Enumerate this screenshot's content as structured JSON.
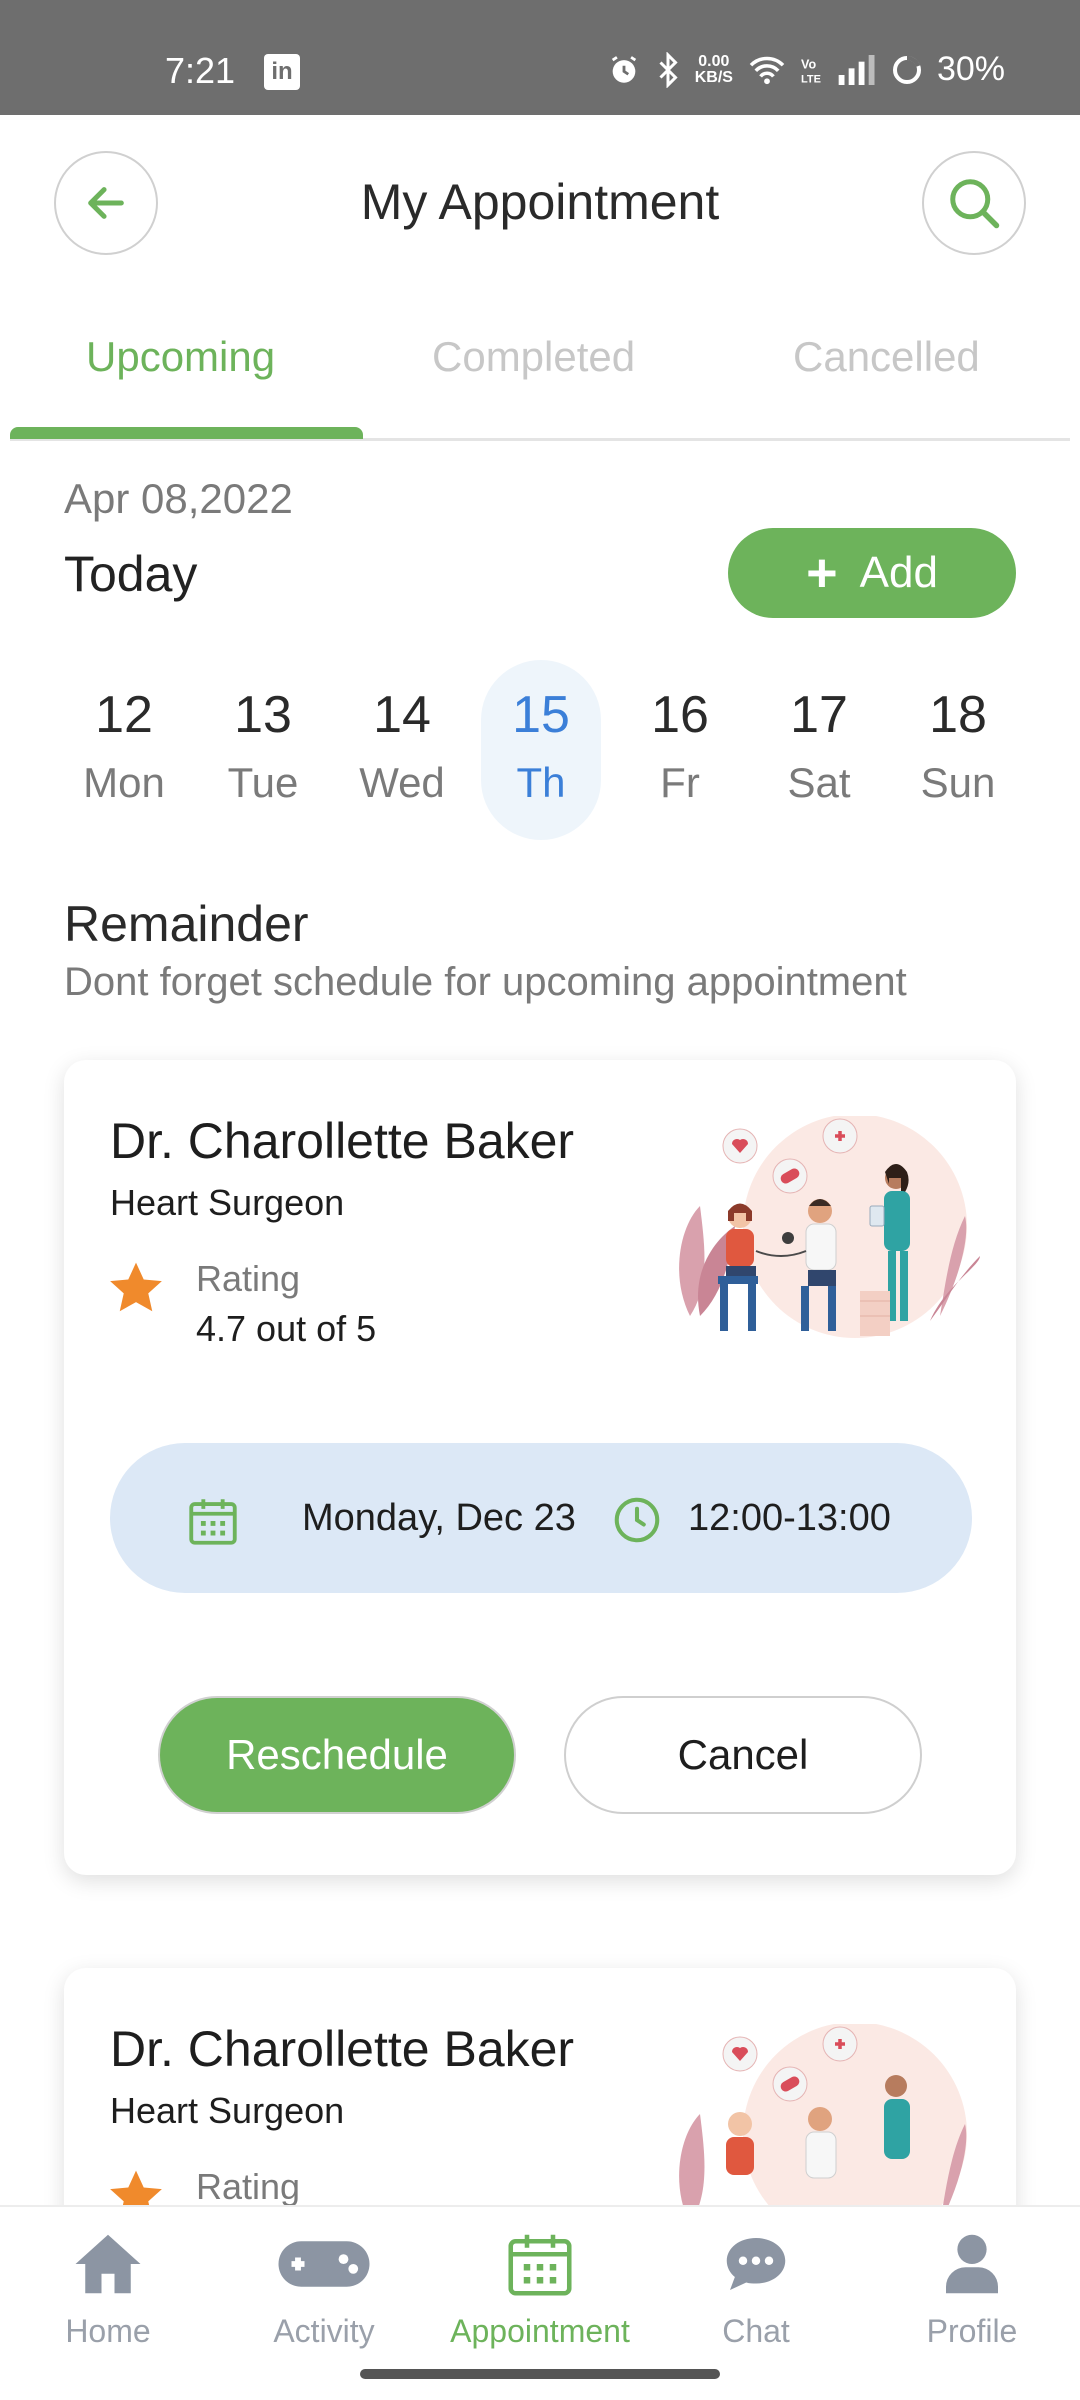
{
  "status_bar": {
    "time": "7:21",
    "app_badge": "in",
    "speed_value": "0.00",
    "speed_unit": "KB/S",
    "battery": "30%",
    "icons": [
      "linkedin-icon",
      "alarm-icon",
      "bluetooth-icon",
      "wifi-icon",
      "volte-icon",
      "signal-icon",
      "battery-icon"
    ]
  },
  "header": {
    "title": "My Appointment",
    "back_icon": "arrow-left-icon",
    "search_icon": "search-icon"
  },
  "tabs": [
    {
      "label": "Upcoming",
      "active": true
    },
    {
      "label": "Completed",
      "active": false
    },
    {
      "label": "Cancelled",
      "active": false
    }
  ],
  "date_section": {
    "date": "Apr 08,2022",
    "heading": "Today",
    "add_label": "Add"
  },
  "week": [
    {
      "num": "12",
      "name": "Mon",
      "selected": false
    },
    {
      "num": "13",
      "name": "Tue",
      "selected": false
    },
    {
      "num": "14",
      "name": "Wed",
      "selected": false
    },
    {
      "num": "15",
      "name": "Th",
      "selected": true
    },
    {
      "num": "16",
      "name": "Fr",
      "selected": false
    },
    {
      "num": "17",
      "name": "Sat",
      "selected": false
    },
    {
      "num": "18",
      "name": "Sun",
      "selected": false
    }
  ],
  "reminder": {
    "title": "Remainder",
    "subtitle": "Dont forget schedule for upcoming appointment"
  },
  "appointments": [
    {
      "doctor": "Dr. Charollette Baker",
      "specialty": "Heart Surgeon",
      "rating_label": "Rating",
      "rating_value": "4.7 out of 5",
      "date": "Monday, Dec 23",
      "time": "12:00-13:00",
      "reschedule_label": "Reschedule",
      "cancel_label": "Cancel"
    },
    {
      "doctor": "Dr. Charollette Baker",
      "specialty": "Heart Surgeon",
      "rating_label": "Rating"
    }
  ],
  "bottom_nav": [
    {
      "label": "Home",
      "icon": "home-icon",
      "active": false
    },
    {
      "label": "Activity",
      "icon": "gamepad-icon",
      "active": false
    },
    {
      "label": "Appointment",
      "icon": "calendar-icon",
      "active": true
    },
    {
      "label": "Chat",
      "icon": "chat-icon",
      "active": false
    },
    {
      "label": "Profile",
      "icon": "profile-icon",
      "active": false
    }
  ],
  "colors": {
    "accent_green": "#6db35b",
    "selected_blue": "#3b7fd8",
    "schedule_bg": "#dce8f6",
    "star_orange": "#f08a2c",
    "inactive_gray": "#9aa0aa"
  }
}
